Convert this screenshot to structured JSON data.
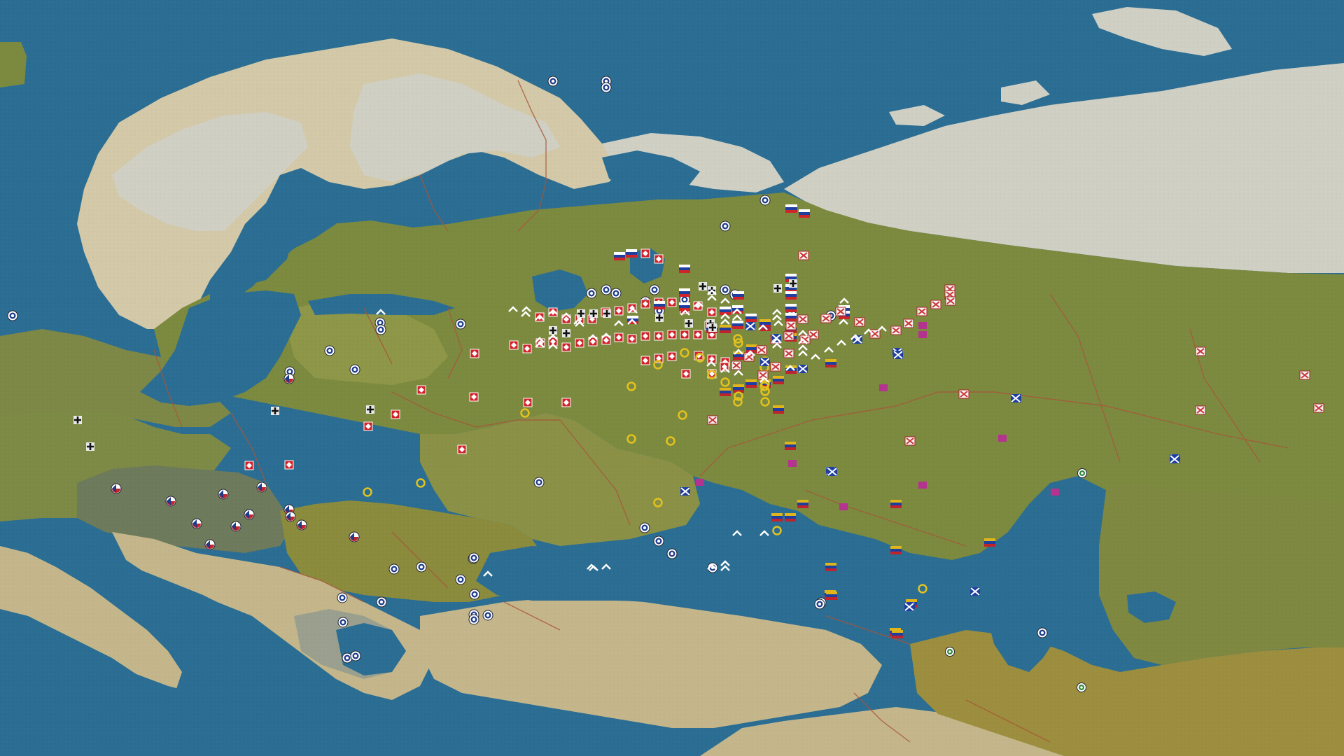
{
  "game": {
    "view": "strategic-map",
    "region": "eastern-europe",
    "colors": {
      "sea": "#2b6d93",
      "sea_deep": "#24628a",
      "snow": "#c8c7b5",
      "steppe": "#c7b98b",
      "forest_olive": "#7b8a3e",
      "olive_dark": "#6b7532",
      "border": "#a8553a"
    },
    "unit_icon_kinds": [
      "roundel-icon",
      "red-diamond-counter-icon",
      "tricolor-flag-icon",
      "gold-ring-icon",
      "white-cross-counter-icon",
      "blue-saltire-icon",
      "magenta-square-icon",
      "czech-roundel-icon",
      "iron-cross-icon",
      "chevron-icon",
      "green-roundel-icon"
    ]
  }
}
